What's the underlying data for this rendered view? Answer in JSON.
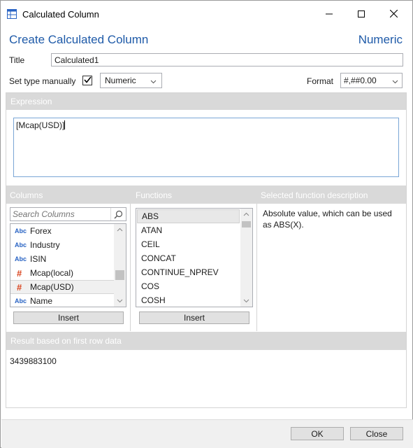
{
  "window": {
    "title": "Calculated Column",
    "controls": {
      "minimize": "minimize",
      "maximize": "maximize",
      "close": "close"
    }
  },
  "header": {
    "heading": "Create Calculated Column",
    "type_label": "Numeric"
  },
  "form": {
    "title_label": "Title",
    "title_value": "Calculated1",
    "set_type_label": "Set type manually",
    "set_type_checked": true,
    "type_value": "Numeric",
    "format_label": "Format",
    "format_value": "#,##0.00"
  },
  "expression": {
    "header": "Expression",
    "value": "[Mcap(USD)]"
  },
  "columns": {
    "header": "Columns",
    "search_placeholder": "Search Columns",
    "items": [
      {
        "type": "Abc",
        "name": "Forex"
      },
      {
        "type": "Abc",
        "name": "Industry"
      },
      {
        "type": "Abc",
        "name": "ISIN"
      },
      {
        "type": "#",
        "name": "Mcap(local)"
      },
      {
        "type": "#",
        "name": "Mcap(USD)"
      },
      {
        "type": "Abc",
        "name": "Name"
      }
    ],
    "selected_index": 4,
    "insert_label": "Insert"
  },
  "functions": {
    "header": "Functions",
    "items": [
      "ABS",
      "ATAN",
      "CEIL",
      "CONCAT",
      "CONTINUE_NPREV",
      "COS",
      "COSH"
    ],
    "selected_index": 0,
    "insert_label": "Insert"
  },
  "description": {
    "header": "Selected function description",
    "text": "Absolute value, which can be used as ABS(X)."
  },
  "result": {
    "header": "Result based on first row data",
    "value": "3439883100"
  },
  "footer": {
    "ok_label": "OK",
    "close_label": "Close"
  },
  "colors": {
    "accent": "#1e5aa8",
    "section_header_bg": "#d9d9d9",
    "number_type": "#d9441e",
    "text_type": "#2a64c4"
  }
}
